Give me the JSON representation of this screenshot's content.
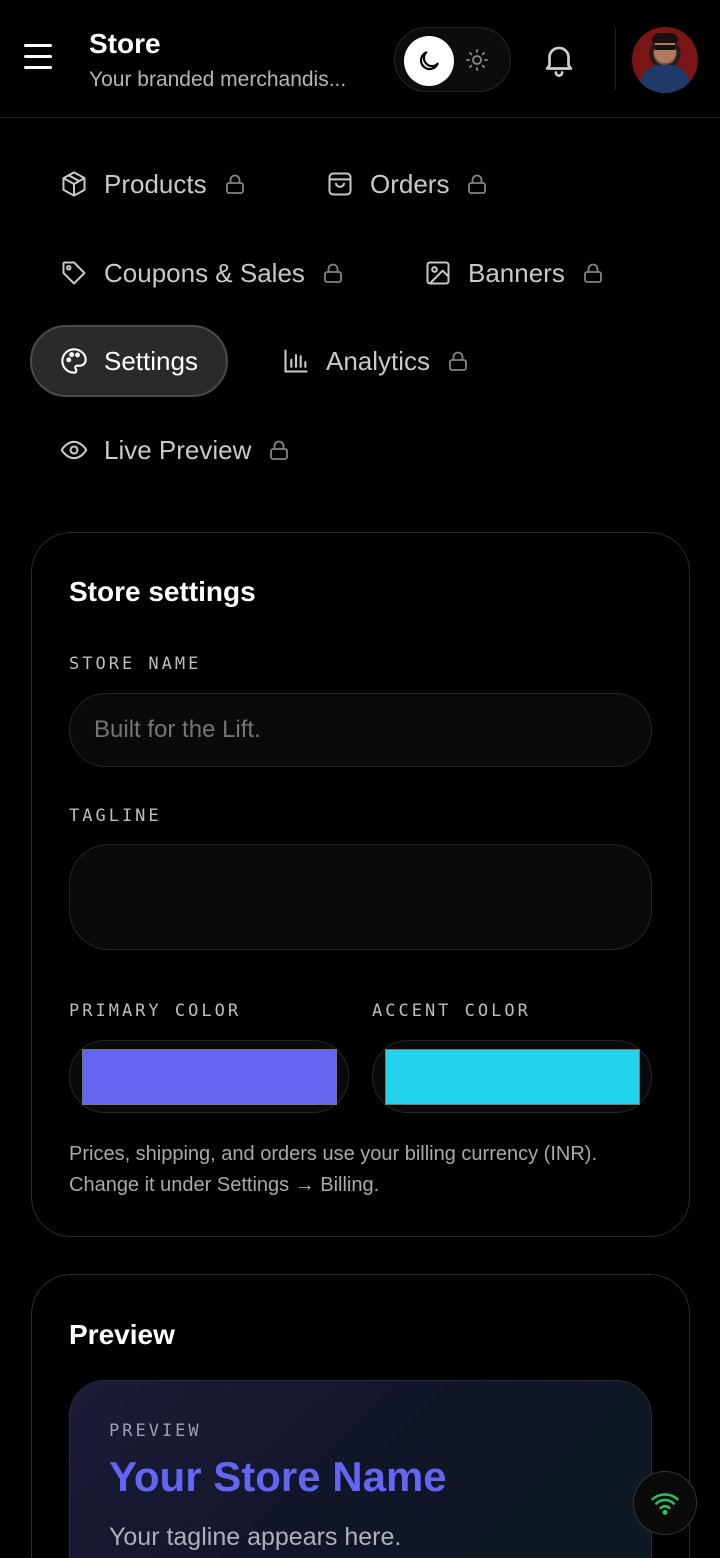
{
  "header": {
    "title": "Store",
    "subtitle": "Your branded merchandis...",
    "menu_icon": "hamburger-menu-icon",
    "theme_icons": [
      "moon-icon",
      "sun-icon"
    ],
    "notification_icon": "bell-icon"
  },
  "nav": {
    "items": [
      {
        "label": "Products",
        "icon": "box-icon",
        "locked": true
      },
      {
        "label": "Orders",
        "icon": "shopping-bag-icon",
        "locked": true
      },
      {
        "label": "Coupons & Sales",
        "icon": "tag-icon",
        "locked": true
      },
      {
        "label": "Banners",
        "icon": "image-icon",
        "locked": true
      },
      {
        "label": "Settings",
        "icon": "palette-icon",
        "locked": false,
        "active": true
      },
      {
        "label": "Analytics",
        "icon": "bar-chart-icon",
        "locked": true
      },
      {
        "label": "Live Preview",
        "icon": "eye-icon",
        "locked": true
      }
    ]
  },
  "settings": {
    "title": "Store settings",
    "store_name_label": "STORE NAME",
    "store_name_placeholder": "Built for the Lift.",
    "tagline_label": "TAGLINE",
    "tagline_value": "",
    "primary_color_label": "PRIMARY COLOR",
    "primary_color": "#6366f1",
    "accent_color_label": "ACCENT COLOR",
    "accent_color": "#22d3ee",
    "note": "Prices, shipping, and orders use your billing currency (INR). Change it under Settings → Billing."
  },
  "preview": {
    "title": "Preview",
    "eyebrow": "PREVIEW",
    "store_name": "Your Store Name",
    "tagline": "Your tagline appears here."
  },
  "fab": {
    "icon": "wifi-icon",
    "color": "#22c55e"
  }
}
